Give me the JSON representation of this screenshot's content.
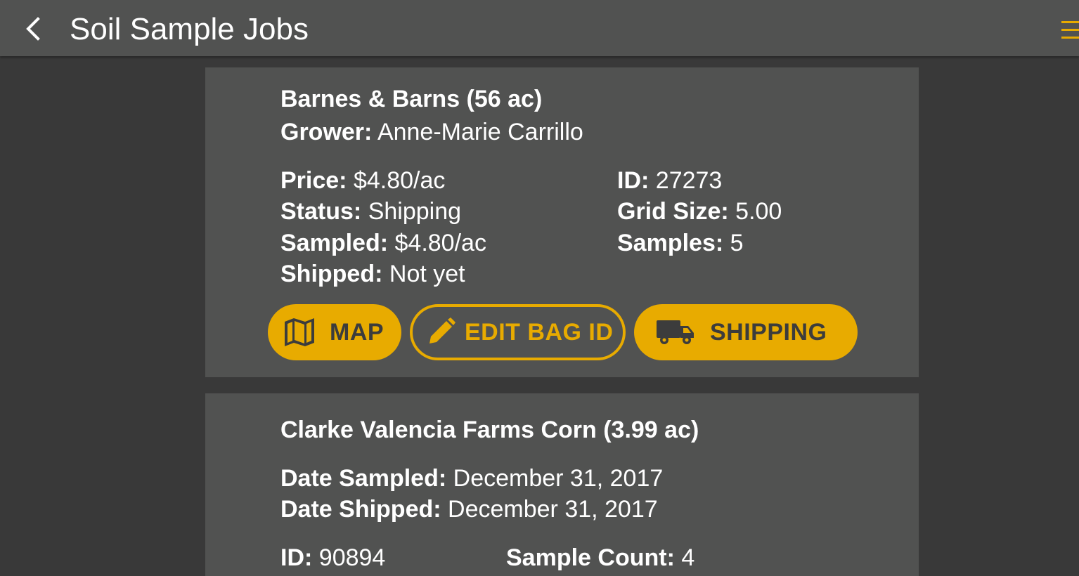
{
  "appbar": {
    "title": "Soil Sample Jobs",
    "back_icon": "chevron-left-icon",
    "menu_icon": "hamburger-menu-icon",
    "accent_color": "#e8ab00"
  },
  "jobs": [
    {
      "title": "Barnes & Barns  (56 ac)",
      "grower_label": "Grower:",
      "grower": "Anne-Marie Carrillo",
      "fields_left": [
        {
          "label": "Price:",
          "value": "$4.80/ac"
        },
        {
          "label": "Status:",
          "value": "Shipping"
        },
        {
          "label": "Sampled:",
          "value": "$4.80/ac"
        },
        {
          "label": "Shipped:",
          "value": "Not yet"
        }
      ],
      "fields_right": [
        {
          "label": "ID:",
          "value": "27273"
        },
        {
          "label": "Grid Size:",
          "value": "5.00"
        },
        {
          "label": "Samples:",
          "value": "5"
        }
      ],
      "buttons": {
        "map": {
          "label": "MAP",
          "icon": "map-icon"
        },
        "edit_bag": {
          "label": "EDIT BAG ID",
          "icon": "pencil-icon"
        },
        "shipping": {
          "label": "SHIPPING",
          "icon": "truck-icon"
        }
      }
    },
    {
      "title": "Clarke Valencia Farms  Corn (3.99 ac)",
      "fields": [
        {
          "label": "Date Sampled:",
          "value": "December 31, 2017"
        },
        {
          "label": "Date Shipped:",
          "value": "December 31, 2017"
        }
      ],
      "fields_bottom": [
        {
          "label": "ID:",
          "value": "90894"
        },
        {
          "label": "Sample Count:",
          "value": "4"
        }
      ]
    }
  ]
}
